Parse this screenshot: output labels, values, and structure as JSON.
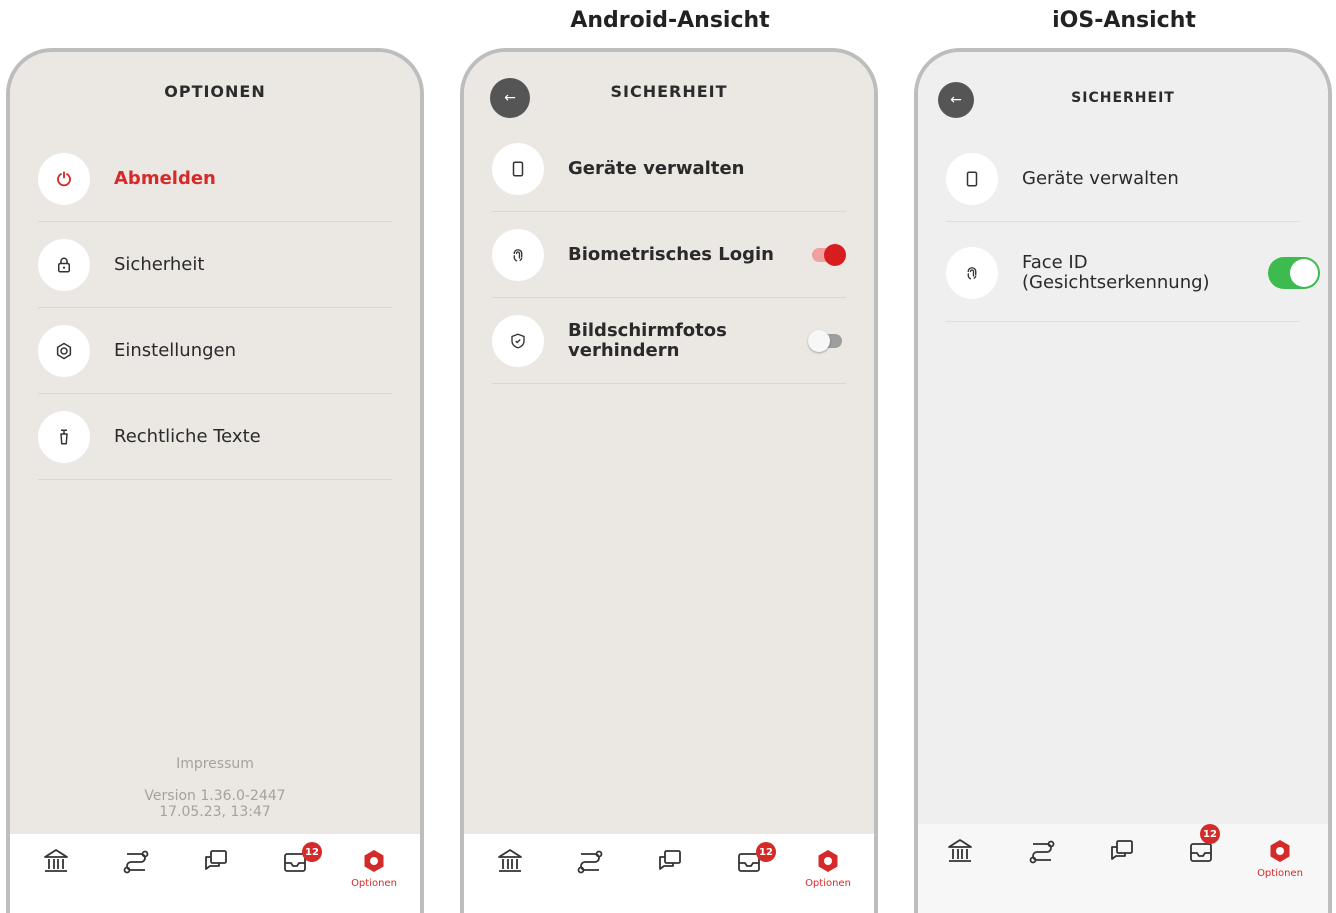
{
  "view_titles": {
    "android": "Android-Ansicht",
    "ios": "iOS-Ansicht"
  },
  "options_screen": {
    "title": "OPTIONEN",
    "items": [
      {
        "label": "Abmelden",
        "icon": "power-icon",
        "accent": "#d42a2a"
      },
      {
        "label": "Sicherheit",
        "icon": "lock-icon"
      },
      {
        "label": "Einstellungen",
        "icon": "settings-icon"
      },
      {
        "label": "Rechtliche Texte",
        "icon": "document-icon"
      }
    ],
    "footer": {
      "impressum": "Impressum",
      "version": "Version 1.36.0-2447",
      "date": "17.05.23, 13:47"
    }
  },
  "android_security": {
    "title": "SICHERHEIT",
    "items": [
      {
        "label": "Geräte verwalten",
        "icon": "phone-icon"
      },
      {
        "label": "Biometrisches Login",
        "icon": "fingerprint-icon",
        "toggle": true
      },
      {
        "label": "Bildschirmfotos\nverhindern",
        "icon": "shield-icon",
        "toggle": false
      }
    ]
  },
  "ios_security": {
    "title": "SICHERHEIT",
    "items": [
      {
        "label": "Geräte verwalten",
        "icon": "phone-icon"
      },
      {
        "label": "Face ID\n(Gesichtserkennung)",
        "icon": "fingerprint-icon",
        "toggle": true
      }
    ]
  },
  "tabbar": {
    "tabs": [
      "bank-icon",
      "transfer-icon",
      "chat-icon",
      "inbox-icon",
      "options-icon"
    ],
    "badge": "12",
    "active_label": "Optionen",
    "active_color": "#d42a2a"
  },
  "colors": {
    "android_toggle_on": "#d71d1d",
    "ios_toggle_on": "#3dbb4f",
    "accent": "#d42a2a"
  }
}
